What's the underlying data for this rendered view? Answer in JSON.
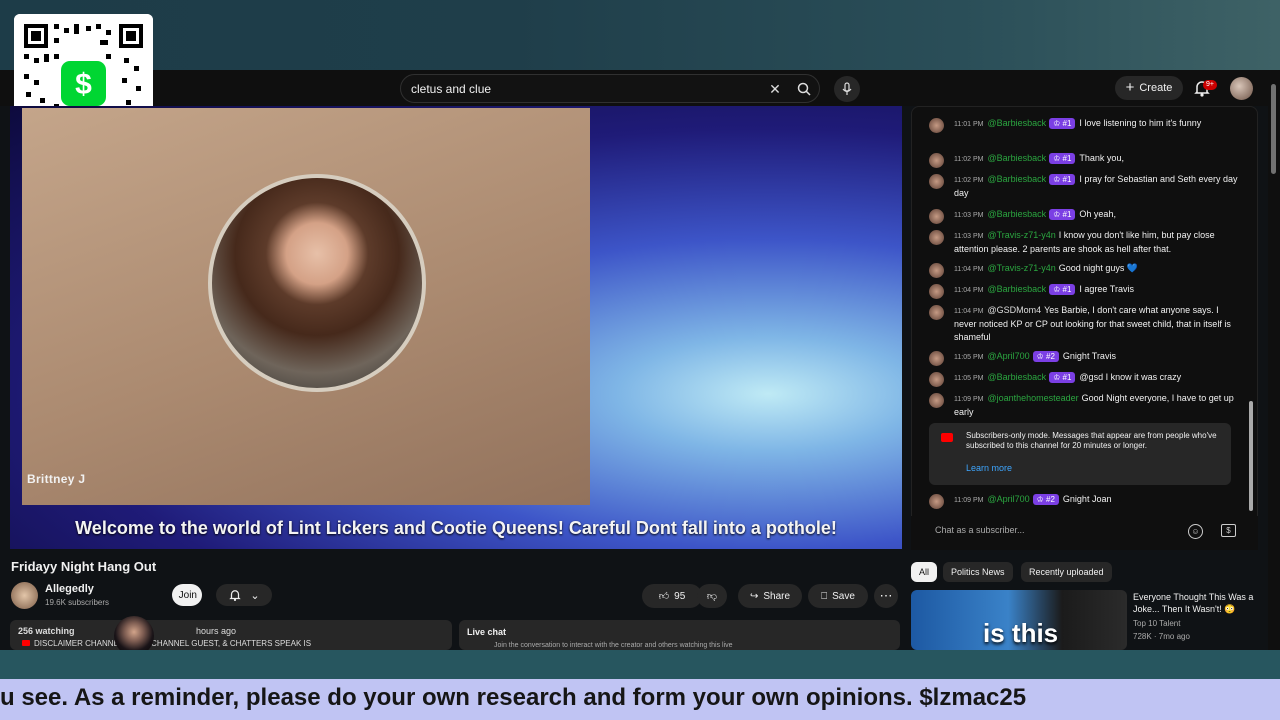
{
  "search": {
    "query": "cletus and clue"
  },
  "header": {
    "create_label": "Create",
    "notif_badge": "9+"
  },
  "video": {
    "cam_name": "Brittney J",
    "caption": "Welcome to the world of Lint Lickers and Cootie Queens!  Careful Dont fall into a pothole!",
    "title": "Fridayy Night Hang Out"
  },
  "channel": {
    "name": "Allegedly",
    "subs": "19.6K subscribers",
    "join_label": "Join"
  },
  "actions": {
    "likes": "95",
    "share": "Share",
    "save": "Save"
  },
  "description": {
    "views": "256 watching",
    "ago": "hours ago",
    "line": "DISCLAIMER CHANNEL HOST, CHANNEL GUEST, & CHATTERS SPEAK IS"
  },
  "livechat_box": {
    "title": "Live chat",
    "sub": "Join the conversation to interact with the creator and others watching this live"
  },
  "overlay": {
    "username": "lzmac25"
  },
  "chat": {
    "messages": [
      {
        "time": "11:01 PM",
        "name": "@Barbiesback",
        "badge": "#1",
        "text": "I love listening to him it's funny"
      },
      {
        "time": "11:02 PM",
        "name": "@Barbiesback",
        "badge": "#1",
        "text": "Thank you,"
      },
      {
        "time": "11:02 PM",
        "name": "@Barbiesback",
        "badge": "#1",
        "text": "I pray for Sebastian and Seth every day day"
      },
      {
        "time": "11:03 PM",
        "name": "@Barbiesback",
        "badge": "#1",
        "text": "Oh yeah,"
      },
      {
        "time": "11:03 PM",
        "name": "@Travis-z71-y4n",
        "badge": "",
        "text": "I know you don't like him, but pay close attention please. 2 parents are shook as hell after that."
      },
      {
        "time": "11:04 PM",
        "name": "@Travis-z71-y4n",
        "badge": "",
        "text": "Good night guys 💙"
      },
      {
        "time": "11:04 PM",
        "name": "@Barbiesback",
        "badge": "#1",
        "text": "I agree Travis"
      },
      {
        "time": "11:04 PM",
        "name": "@GSDMom4",
        "badge": "",
        "text": "Yes Barbie, I don't care what anyone says. I never noticed KP or CP out looking for that sweet child, that in itself is shameful"
      },
      {
        "time": "11:05 PM",
        "name": "@April700",
        "badge": "#2",
        "text": "Gnight Travis"
      },
      {
        "time": "11:05 PM",
        "name": "@Barbiesback",
        "badge": "#1",
        "text": "@gsd I know it was crazy"
      },
      {
        "time": "11:09 PM",
        "name": "@joanthehomesteader",
        "badge": "",
        "text": "Good Night everyone, I have to get up early"
      },
      {
        "time": "11:09 PM",
        "name": "@April700",
        "badge": "#2",
        "text": "Gnight Joan"
      }
    ],
    "sub_notice": "Subscribers-only mode. Messages that appear are from people who've subscribed to this channel for 20 minutes or longer.",
    "learn_more": "Learn more",
    "input_placeholder": "Chat as a subscriber..."
  },
  "chips": [
    "All",
    "Politics News",
    "Recently uploaded"
  ],
  "recommended": {
    "thumb_text": "is this",
    "title": "Everyone Thought This Was a Joke... Then It Wasn't! 😳",
    "channel": "Top 10 Talent",
    "meta": "728K · 7mo ago"
  },
  "ticker": {
    "text": "u see. As a reminder, please do your own research and form your own opinions. $lzmac25"
  }
}
